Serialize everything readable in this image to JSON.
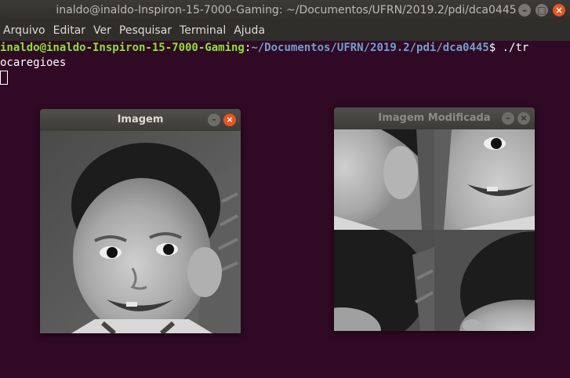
{
  "window": {
    "title": "inaldo@inaldo-Inspiron-15-7000-Gaming: ~/Documentos/UFRN/2019.2/pdi/dca0445",
    "minimize_icon": "minimize-icon",
    "maximize_icon": "maximize-icon",
    "close_icon": "close-icon"
  },
  "menu": {
    "items": [
      "Arquivo",
      "Editar",
      "Ver",
      "Pesquisar",
      "Terminal",
      "Ajuda"
    ]
  },
  "terminal": {
    "prompt_user": "inaldo@inaldo-Inspiron-15-7000-Gaming",
    "prompt_sep": ":",
    "prompt_path": "~/Documentos/UFRN/2019.2/pdi/dca0445",
    "prompt_symbol": "$ ",
    "command_part1": "./tr",
    "command_part2": "ocaregioes"
  },
  "image_window": {
    "title": "Imagem"
  },
  "modified_window": {
    "title": "Imagem Modificada"
  },
  "colors": {
    "terminal_bg": "#300a24",
    "prompt_user": "#8ae234",
    "prompt_path": "#729fcf",
    "close_accent": "#e95420"
  }
}
